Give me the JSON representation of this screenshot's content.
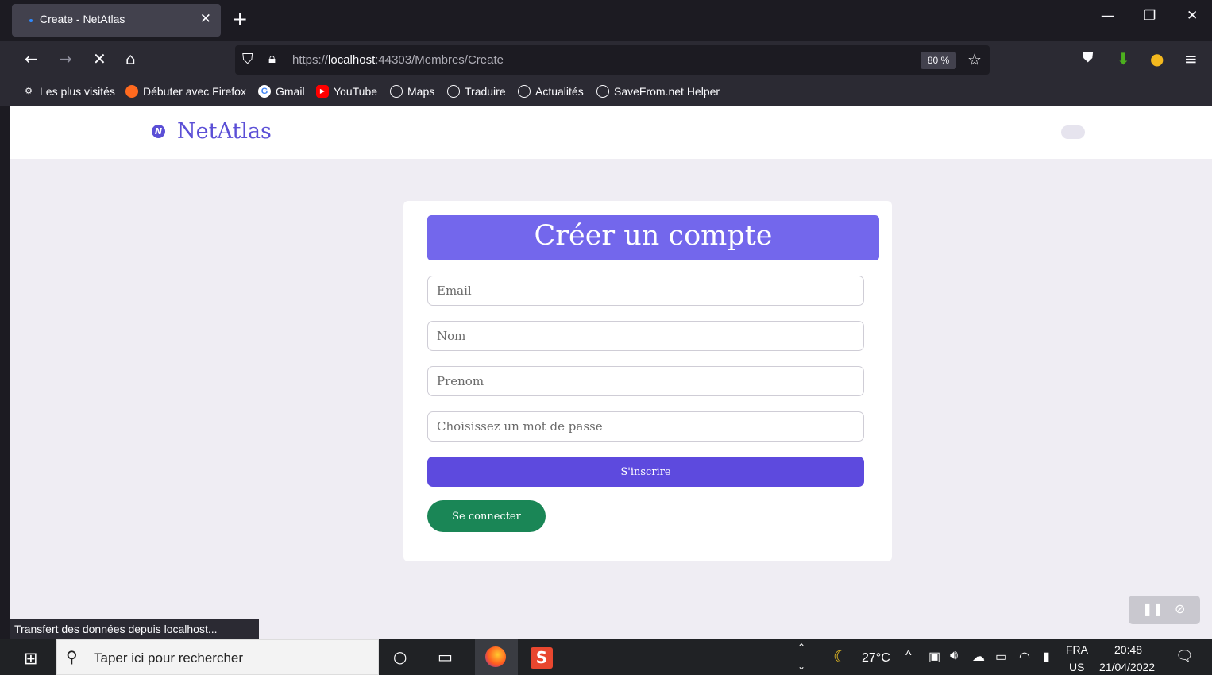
{
  "browser": {
    "tab_title": "Create - NetAtlas",
    "url_prefix": "https://",
    "url_host": "localhost",
    "url_path": ":44303/Membres/Create",
    "zoom": "80 %",
    "bookmarks": [
      {
        "label": "Les plus visités"
      },
      {
        "label": "Débuter avec Firefox"
      },
      {
        "label": "Gmail"
      },
      {
        "label": "YouTube"
      },
      {
        "label": "Maps"
      },
      {
        "label": "Traduire"
      },
      {
        "label": "Actualités"
      },
      {
        "label": "SaveFrom.net Helper"
      }
    ],
    "status": "Transfert des données depuis localhost..."
  },
  "site": {
    "brand": "NetAtlas",
    "logo_letter": "N"
  },
  "form": {
    "title": "Créer un compte",
    "email_placeholder": "Email",
    "nom_placeholder": "Nom",
    "prenom_placeholder": "Prenom",
    "password_placeholder": "Choisissez un mot de passe",
    "signup_label": "S'inscrire",
    "login_label": "Se connecter"
  },
  "colors": {
    "brand": "#5b4fd6",
    "header_bg": "#7367ec",
    "signup_bg": "#5d4ade",
    "login_bg": "#1a8656"
  },
  "taskbar": {
    "search_placeholder": "Taper ici pour rechercher",
    "temperature": "27°C",
    "lang_top": "FRA",
    "lang_bottom": "US",
    "time": "20:48",
    "date": "21/04/2022"
  }
}
